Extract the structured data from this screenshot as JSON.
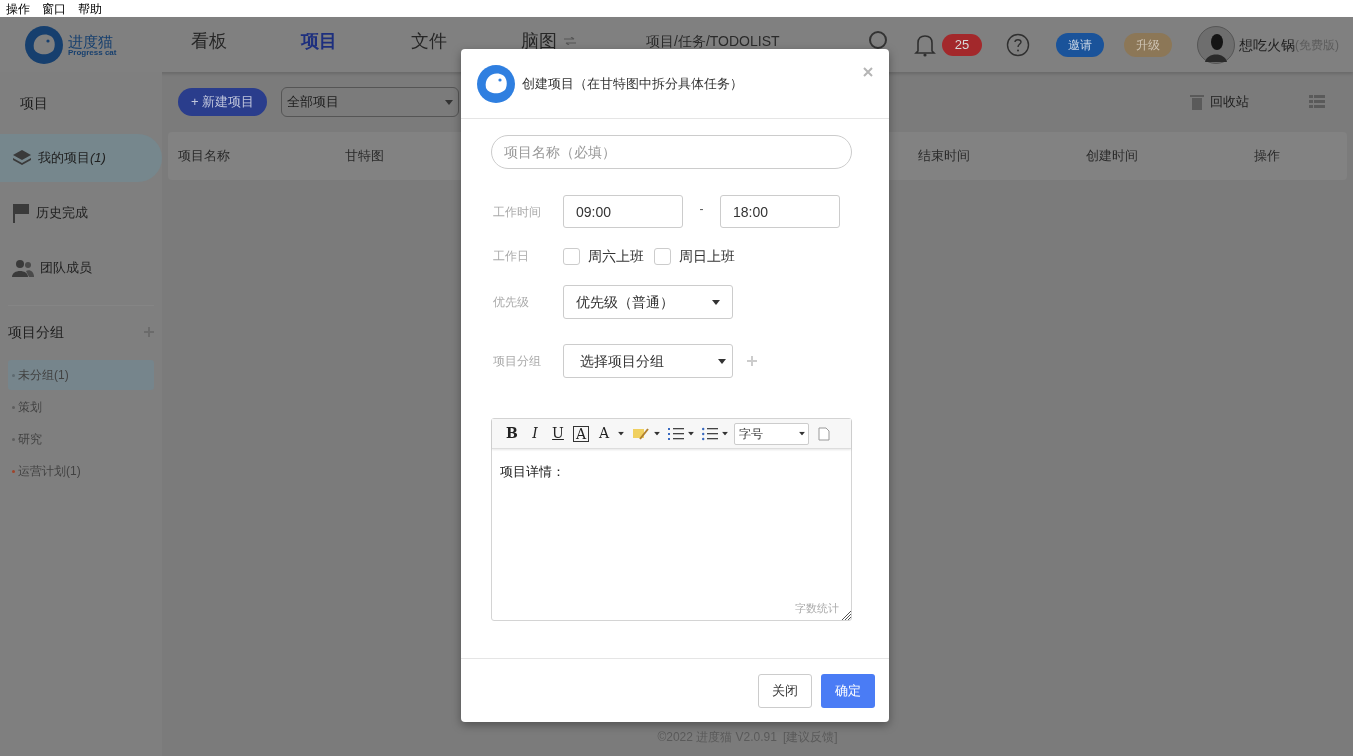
{
  "menu_bar": [
    {
      "label": "操作"
    },
    {
      "label": "窗口"
    },
    {
      "label": "帮助"
    }
  ],
  "header": {
    "logo": {
      "name": "进度猫",
      "tagline": "Progress cat"
    },
    "nav": [
      {
        "label": "看板",
        "selected": false
      },
      {
        "label": "项目",
        "selected": true
      },
      {
        "label": "文件",
        "selected": false
      },
      {
        "label": "脑图",
        "selected": false
      }
    ],
    "search": {
      "placeholder": "项目/任务/TODOLIST"
    },
    "notifications": "25",
    "invite": "邀请",
    "upgrade": "升级",
    "user": {
      "name": "想吃火锅",
      "plan": "(免费版)"
    }
  },
  "sidebar": {
    "title": "项目",
    "items": [
      {
        "kind": "layers",
        "label": "我的项目",
        "count": "(1)",
        "selected": true
      },
      {
        "kind": "flag",
        "label": "历史完成",
        "selected": false
      },
      {
        "kind": "team",
        "label": "团队成员",
        "selected": false
      }
    ],
    "groups_title": "项目分组",
    "groups": [
      {
        "label": "未分组(1)",
        "selected": true,
        "color": "#5e6a70"
      },
      {
        "label": "策划",
        "selected": false,
        "color": "#5e5e5e"
      },
      {
        "label": "研究",
        "selected": false,
        "color": "#5e5e5e"
      },
      {
        "label": "运营计划(1)",
        "selected": false,
        "color": "#a0442a"
      }
    ]
  },
  "toolbar": {
    "new_button": "+ 新建项目",
    "filter": "全部项目",
    "recycle": "回收站"
  },
  "table": {
    "columns": [
      "项目名称",
      "甘特图",
      "结束时间",
      "创建时间",
      "操作"
    ]
  },
  "modal": {
    "title": "创建项目（在甘特图中拆分具体任务）",
    "name_placeholder": "项目名称（必填）",
    "work_time": {
      "label": "工作时间",
      "start": "09:00",
      "separator": "-",
      "end": "18:00"
    },
    "workdays": {
      "label": "工作日",
      "options": [
        {
          "label": "周六上班",
          "checked": false
        },
        {
          "label": "周日上班",
          "checked": false
        }
      ]
    },
    "priority": {
      "label": "优先级",
      "value": "优先级（普通）"
    },
    "group": {
      "label": "项目分组",
      "value": "选择项目分组"
    },
    "editor": {
      "tools": [
        {
          "kind": "bold",
          "label": "B"
        },
        {
          "kind": "italic",
          "label": "I"
        },
        {
          "kind": "underline",
          "label": "U"
        },
        {
          "kind": "boxed",
          "label": "A"
        },
        {
          "kind": "color",
          "label": "A"
        }
      ],
      "font_size": "字号",
      "content": "项目详情：",
      "word_count": "字数统计"
    },
    "buttons": {
      "close": "关闭",
      "confirm": "确定"
    }
  },
  "footer": {
    "copyright": "©2022 进度猫 V2.0.91",
    "feedback": "[建议反馈]"
  }
}
